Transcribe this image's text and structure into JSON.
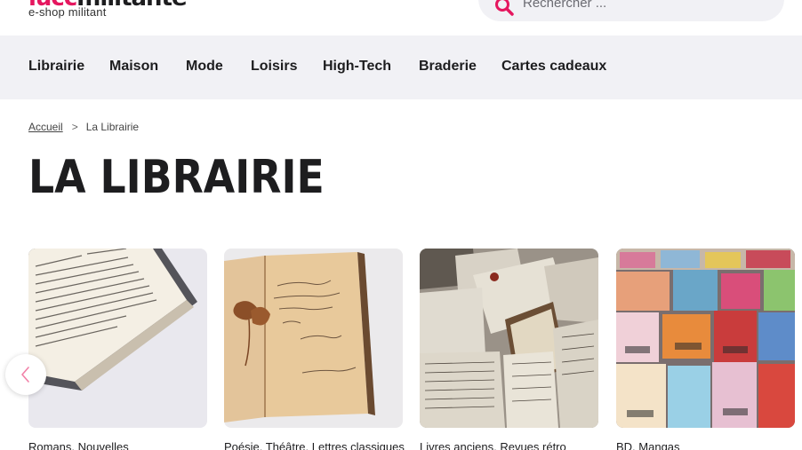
{
  "header": {
    "logo_part1": "lucc",
    "logo_part2": "militante",
    "tagline": "e-shop militant",
    "search_placeholder": "Rechercher ...",
    "accent_color": "#e5175f"
  },
  "nav": {
    "items": [
      {
        "label": "Librairie"
      },
      {
        "label": "Maison"
      },
      {
        "label": "Mode"
      },
      {
        "label": "Loisirs"
      },
      {
        "label": "High-Tech"
      },
      {
        "label": "Braderie"
      },
      {
        "label": "Cartes cadeaux"
      }
    ]
  },
  "breadcrumb": {
    "home": "Accueil",
    "separator": ">",
    "current": "La Librairie"
  },
  "page": {
    "title": "LA LIBRAIRIE"
  },
  "categories": [
    {
      "label": "Romans, Nouvelles",
      "image": "open-book-photo"
    },
    {
      "label": "Poésie, Théâtre, Lettres classiques",
      "image": "old-notebook-photo"
    },
    {
      "label": "Livres anciens, Revues rétro",
      "image": "old-books-pile-photo"
    },
    {
      "label": "BD, Mangas",
      "image": "manga-stacks-photo"
    }
  ],
  "carousel": {
    "prev_icon": "chevron-left-icon"
  }
}
